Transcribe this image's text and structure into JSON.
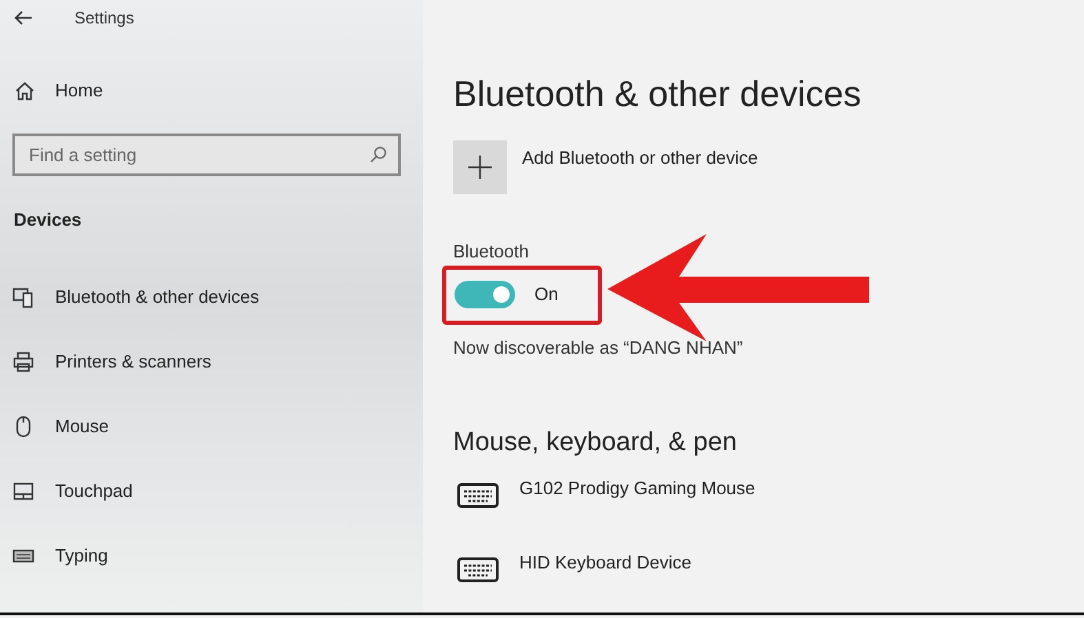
{
  "window": {
    "title": "Settings"
  },
  "sidebar": {
    "home": "Home",
    "search": {
      "placeholder": "Find a setting"
    },
    "section": "Devices",
    "items": [
      {
        "label": "Bluetooth & other devices",
        "kind": "bluetooth"
      },
      {
        "label": "Printers & scanners",
        "kind": "printer"
      },
      {
        "label": "Mouse",
        "kind": "mouse"
      },
      {
        "label": "Touchpad",
        "kind": "touchpad"
      },
      {
        "label": "Typing",
        "kind": "typing"
      }
    ]
  },
  "main": {
    "title": "Bluetooth & other devices",
    "add_device": "Add Bluetooth or other device",
    "bluetooth": {
      "label": "Bluetooth",
      "on": true,
      "state_text": "On",
      "discoverable": "Now discoverable as “DANG NHAN”"
    },
    "section": "Mouse, keyboard, & pen",
    "devices": [
      {
        "name": "G102 Prodigy Gaming Mouse"
      },
      {
        "name": "HID Keyboard Device"
      }
    ]
  }
}
